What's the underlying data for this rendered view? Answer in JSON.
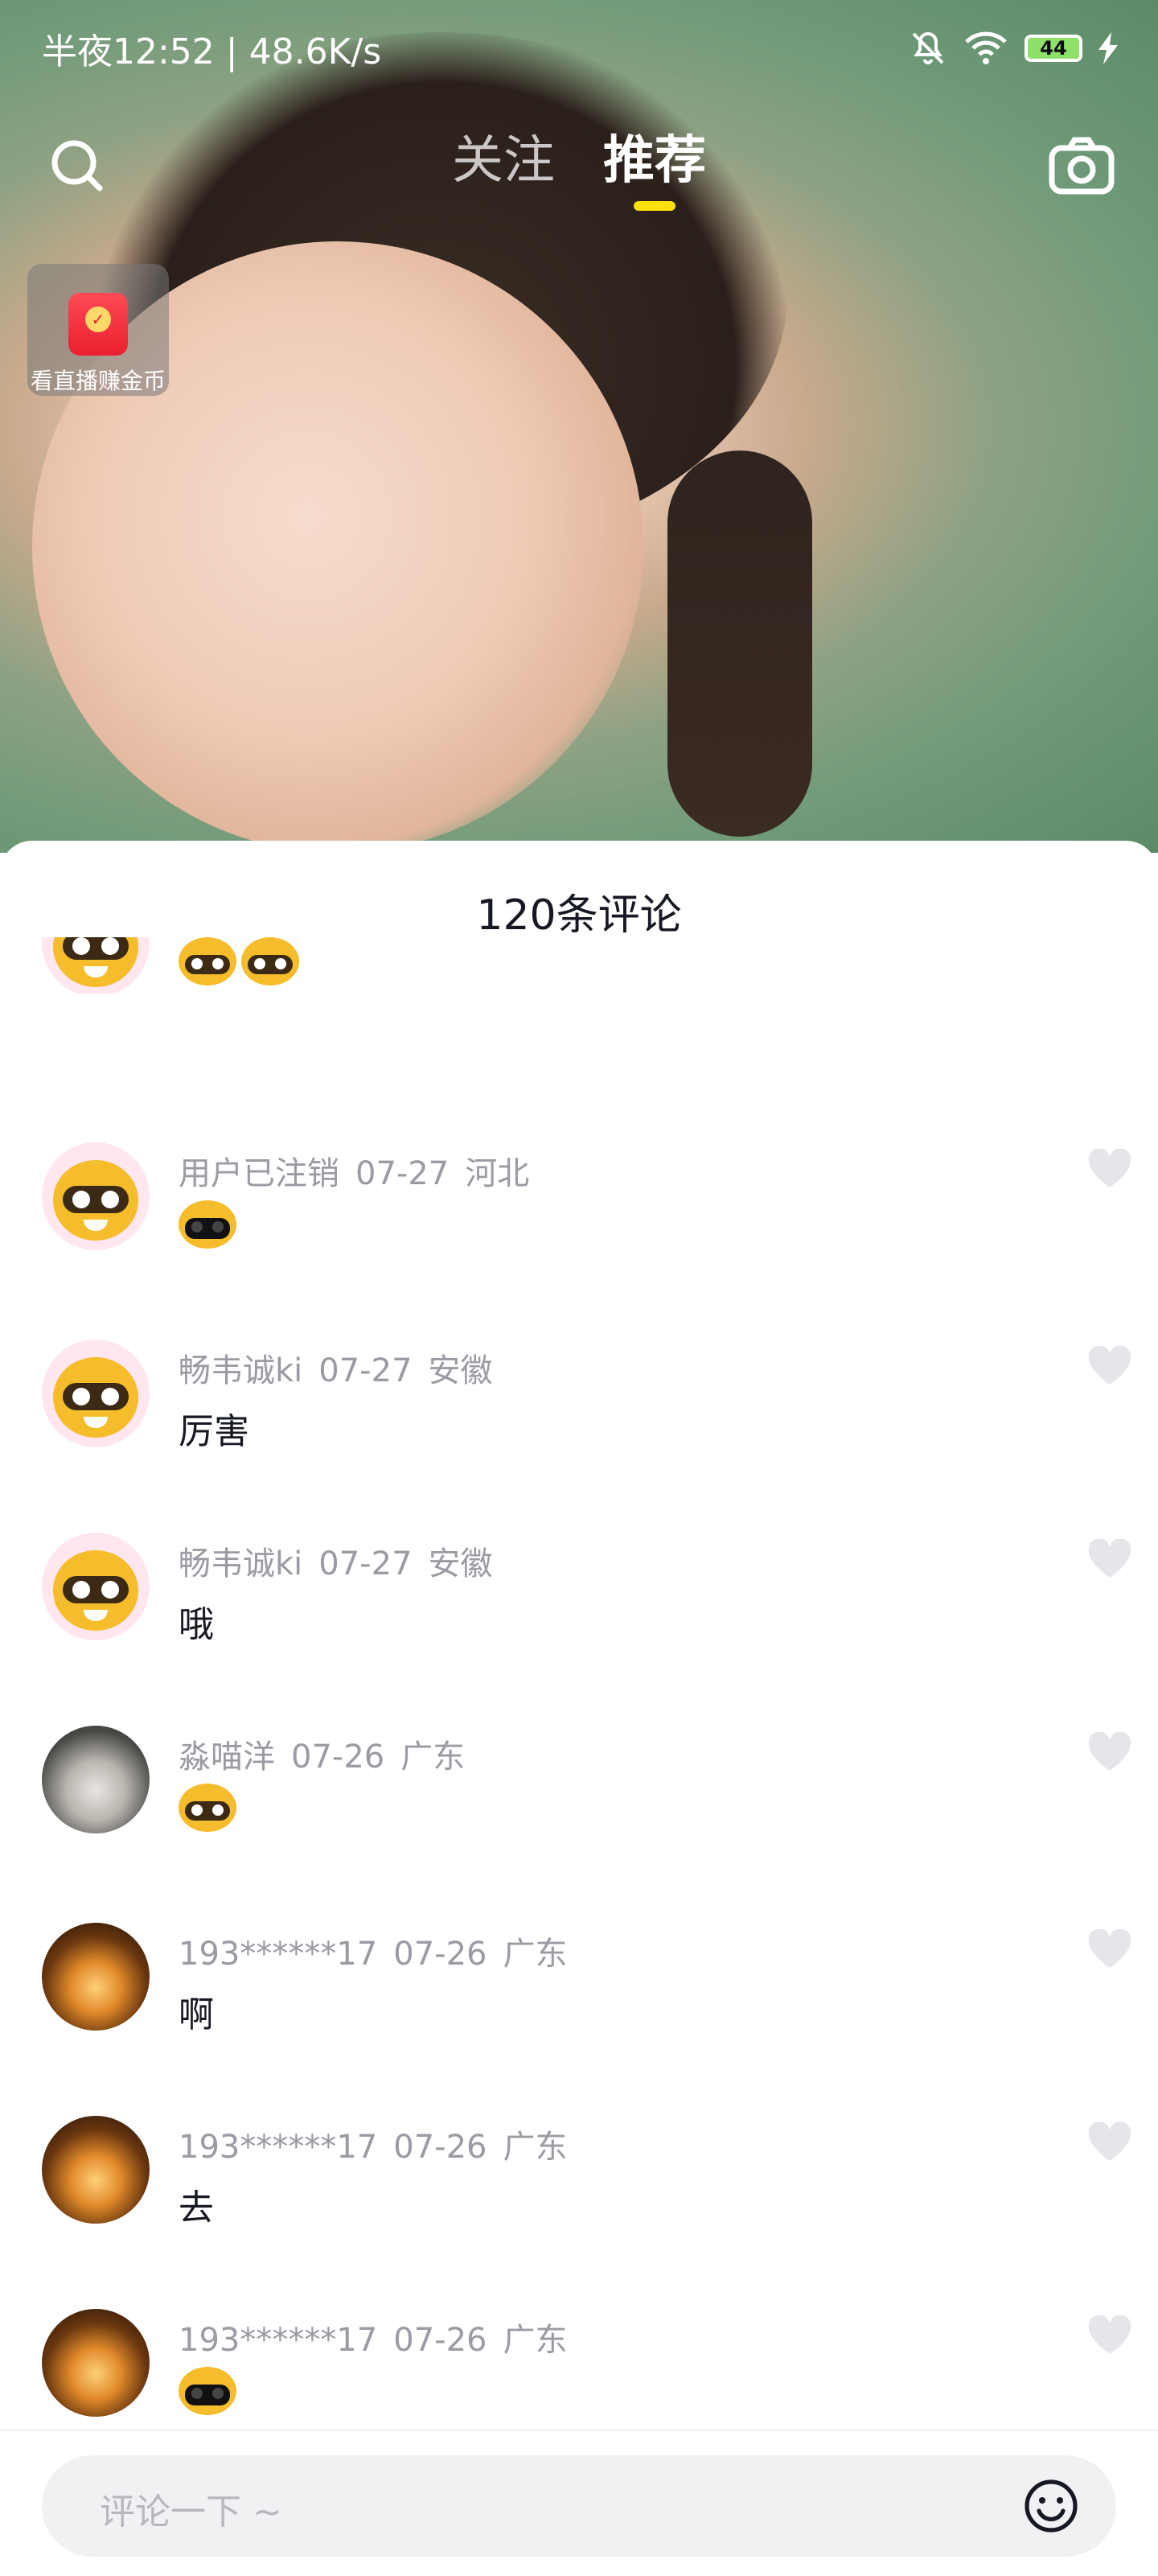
{
  "status_bar": {
    "time_speed": "半夜12:52 | 48.6K/s",
    "battery": "44",
    "icons": [
      "mute-bell-icon",
      "wifi-icon",
      "battery-icon",
      "charging-bolt-icon"
    ]
  },
  "top_nav": {
    "tabs": [
      {
        "label": "关注",
        "active": false
      },
      {
        "label": "推荐",
        "active": true
      }
    ],
    "active_indicator_color": "#ffe10a",
    "icons": [
      "search-icon",
      "camera-icon"
    ]
  },
  "live_badge": {
    "label": "看直播赚金币",
    "icon": "red-packet-icon"
  },
  "comments_sheet": {
    "title": "120条评论",
    "comments": [
      {
        "user": "用户已注销",
        "date": "07-27",
        "location": "河北",
        "text": "",
        "emoji": [
          "sunglasses-raccoon-emoji"
        ],
        "avatar": "raccoon"
      },
      {
        "user": "畅韦诚ki",
        "date": "07-27",
        "location": "安徽",
        "text": "厉害",
        "emoji": [],
        "avatar": "raccoon"
      },
      {
        "user": "畅韦诚ki",
        "date": "07-27",
        "location": "安徽",
        "text": "哦",
        "emoji": [],
        "avatar": "raccoon"
      },
      {
        "user": "淼喵洋",
        "date": "07-26",
        "location": "广东",
        "text": "",
        "emoji": [
          "shocked-raccoon-emoji"
        ],
        "avatar": "cat"
      },
      {
        "user": "193******17",
        "date": "07-26",
        "location": "广东",
        "text": "啊",
        "emoji": [],
        "avatar": "lantern"
      },
      {
        "user": "193******17",
        "date": "07-26",
        "location": "广东",
        "text": "去",
        "emoji": [],
        "avatar": "lantern"
      },
      {
        "user": "193******17",
        "date": "07-26",
        "location": "广东",
        "text": "",
        "emoji": [
          "sunglasses-raccoon-emoji"
        ],
        "avatar": "lantern"
      }
    ]
  },
  "comment_input": {
    "placeholder": "评论一下 ~",
    "icon": "emoji-icon"
  },
  "colors": {
    "text_primary": "#161823",
    "text_meta": "#9a9ba3",
    "accent_yellow": "#ffe10a",
    "sheet_bg": "#ffffff",
    "input_bg": "#f1f1f4"
  }
}
